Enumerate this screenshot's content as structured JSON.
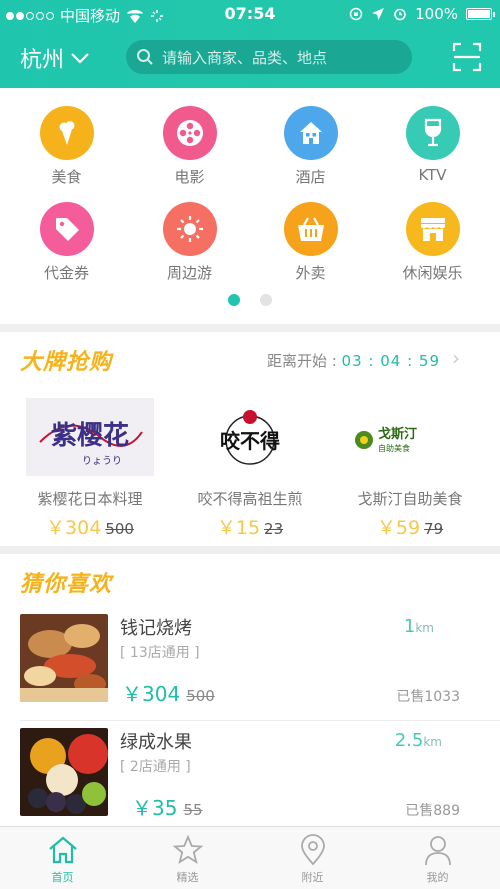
{
  "status": {
    "carrier": "中国移动",
    "time": "07:54",
    "battery": "100%"
  },
  "nav": {
    "city": "杭州",
    "search_placeholder": "请输入商家、品类、地点"
  },
  "categories": [
    {
      "label": "美食",
      "color": "#f6b21a",
      "icon": "ice-cream-icon"
    },
    {
      "label": "电影",
      "color": "#f05a8c",
      "icon": "film-reel-icon"
    },
    {
      "label": "酒店",
      "color": "#4da7ea",
      "icon": "house-icon"
    },
    {
      "label": "KTV",
      "color": "#37cbb6",
      "icon": "wine-glass-icon"
    },
    {
      "label": "代金券",
      "color": "#f45c9a",
      "icon": "tag-icon"
    },
    {
      "label": "周边游",
      "color": "#f57062",
      "icon": "sun-icon"
    },
    {
      "label": "外卖",
      "color": "#f6a21a",
      "icon": "basket-icon"
    },
    {
      "label": "休闲娱乐",
      "color": "#f7b81d",
      "icon": "shop-icon"
    }
  ],
  "brand": {
    "title": "大牌抢购",
    "countdown_label": "距离开始 :",
    "countdown": "03 : 04 : 59",
    "deals": [
      {
        "name": "紫樱花日本料理",
        "price": "￥304",
        "old": "500",
        "logo_text": "紫樱花",
        "logo_sub": "りょうり"
      },
      {
        "name": "咬不得高祖生煎",
        "price": "￥15",
        "old": "23",
        "logo_text": "咬不得",
        "logo_sub": ""
      },
      {
        "name": "戈斯汀自助美食",
        "price": "￥59",
        "old": "79",
        "logo_text": "戈斯汀",
        "logo_sub": "自助美食"
      }
    ]
  },
  "guess": {
    "title": "猜你喜欢",
    "items": [
      {
        "name": "钱记烧烤",
        "stores": "[ 13店通用 ]",
        "price": "￥304",
        "old": "500",
        "distance": "1",
        "unit": "km",
        "sold": "已售1033"
      },
      {
        "name": "绿成水果",
        "stores": "[ 2店通用 ]",
        "price": "￥35",
        "old": "55",
        "distance": "2.5",
        "unit": "km",
        "sold": "已售889"
      }
    ]
  },
  "tabs": [
    {
      "label": "首页",
      "icon": "home-icon"
    },
    {
      "label": "精选",
      "icon": "star-icon"
    },
    {
      "label": "附近",
      "icon": "location-pin-icon"
    },
    {
      "label": "我的",
      "icon": "user-icon"
    }
  ]
}
